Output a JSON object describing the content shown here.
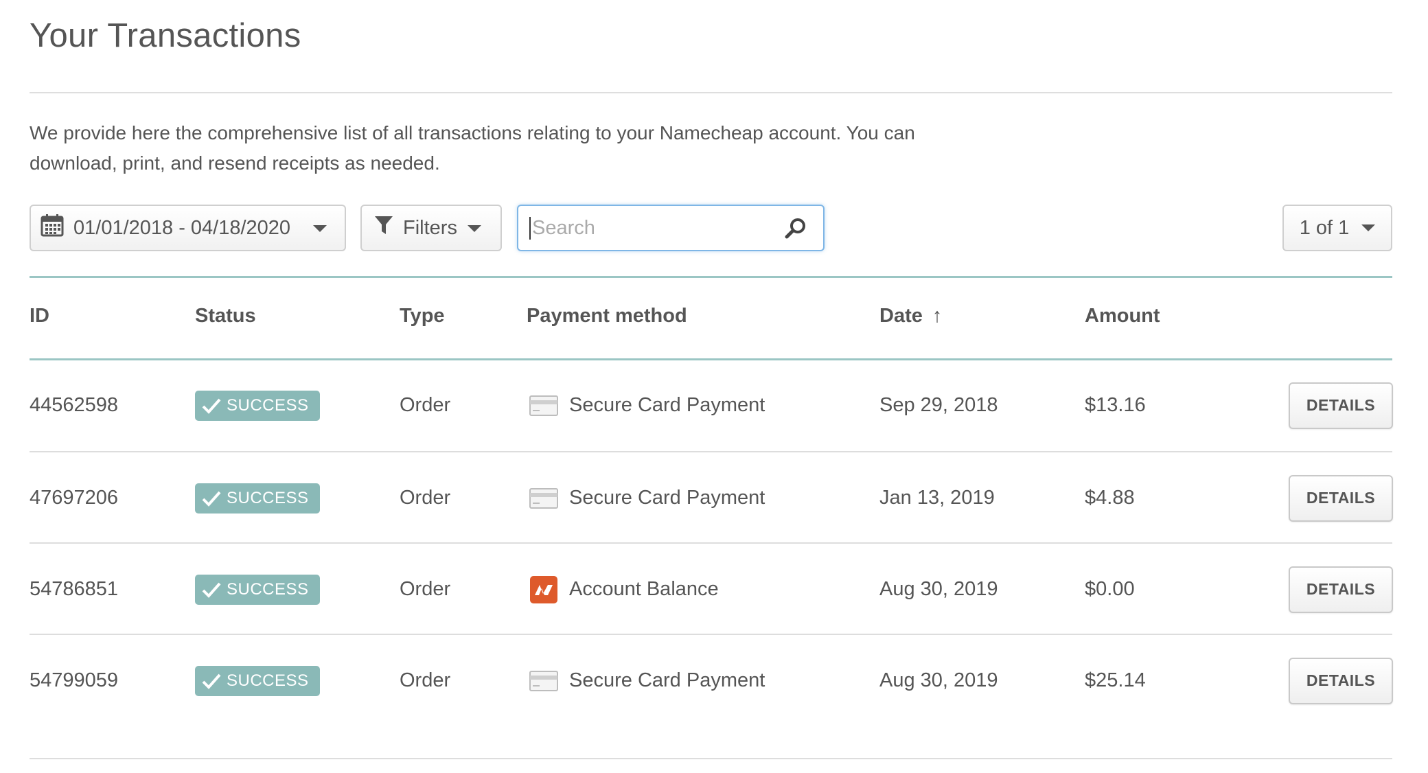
{
  "header": {
    "title": "Your Transactions",
    "intro": "We provide here the comprehensive list of all transactions relating to your Namecheap account. You can download, print, and resend receipts as needed."
  },
  "toolbar": {
    "date_range": "01/01/2018 - 04/18/2020",
    "filters_label": "Filters",
    "search_placeholder": "Search",
    "search_value": "",
    "pager": "1 of 1"
  },
  "table": {
    "columns": {
      "id": "ID",
      "status": "Status",
      "type": "Type",
      "payment_method": "Payment method",
      "date": "Date",
      "amount": "Amount"
    },
    "sort_indicator": "↑",
    "rows": [
      {
        "id": "44562598",
        "status": "SUCCESS",
        "type": "Order",
        "payment_method": "Secure Card Payment",
        "payment_icon": "credit-card-icon",
        "date": "Sep 29, 2018",
        "amount": "$13.16",
        "action": "DETAILS"
      },
      {
        "id": "47697206",
        "status": "SUCCESS",
        "type": "Order",
        "payment_method": "Secure Card Payment",
        "payment_icon": "credit-card-icon",
        "date": "Jan 13, 2019",
        "amount": "$4.88",
        "action": "DETAILS"
      },
      {
        "id": "54786851",
        "status": "SUCCESS",
        "type": "Order",
        "payment_method": "Account Balance",
        "payment_icon": "namecheap-logo-icon",
        "date": "Aug 30, 2019",
        "amount": "$0.00",
        "action": "DETAILS"
      },
      {
        "id": "54799059",
        "status": "SUCCESS",
        "type": "Order",
        "payment_method": "Secure Card Payment",
        "payment_icon": "credit-card-icon",
        "date": "Aug 30, 2019",
        "amount": "$25.14",
        "action": "DETAILS"
      }
    ]
  },
  "colors": {
    "success_badge": "#8ab9b7",
    "table_rule": "#9bc6c4",
    "brand_orange": "#de5a2b",
    "search_focus": "#7fb6e6"
  }
}
